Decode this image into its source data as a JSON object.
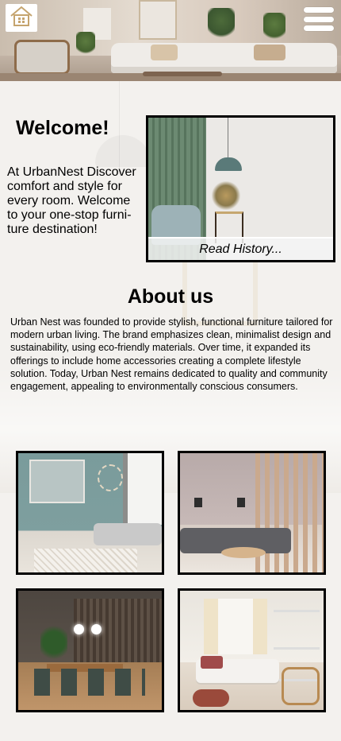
{
  "header": {
    "logo_icon": "house-logo-icon",
    "menu_icon": "hamburger-menu-icon"
  },
  "welcome": {
    "title": "Welcome!",
    "text": "At UrbanNest Discover comfort and style for every room. Welcome to your one-stop furni-ture destination!"
  },
  "history": {
    "link_label": "Read History..."
  },
  "about": {
    "title": "About us",
    "text": "Urban Nest was founded to provide stylish, functional furniture tailored for modern urban living. The brand emphasizes clean, minimalist design and sustainability, using eco-friendly materials. Over time, it expanded its offerings to include home accessories creating a complete lifestyle solution. Today, Urban Nest remains dedicated to quality and community engagement, appealing to environmentally conscious consumers."
  },
  "colors": {
    "background": "#f3f1ee",
    "text": "#000000",
    "frame_border": "#000000"
  }
}
